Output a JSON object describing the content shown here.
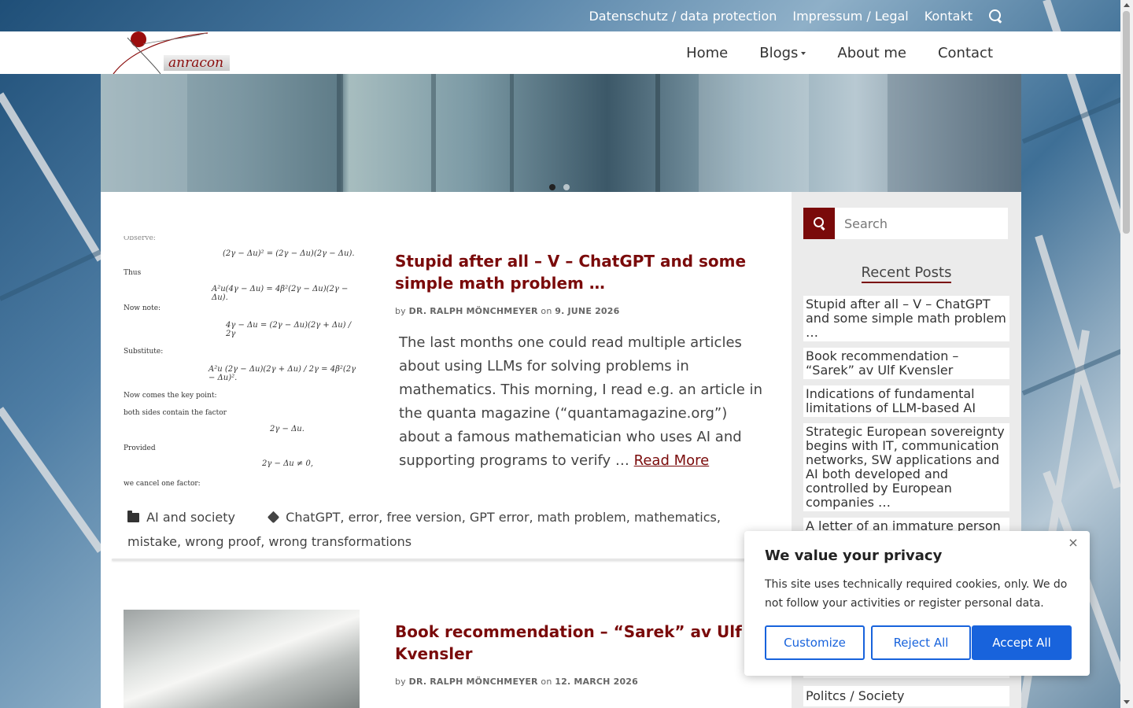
{
  "topbar": {
    "links": [
      "Datenschutz / data protection",
      "Impressum / Legal",
      "Kontakt"
    ],
    "search_icon": "search-icon"
  },
  "header": {
    "logo_text": "anracon",
    "nav": {
      "home": "Home",
      "blogs": "Blogs",
      "about": "About me",
      "contact": "Contact"
    }
  },
  "hero": {
    "slides_total": 2,
    "active_slide": 1
  },
  "posts": [
    {
      "title": "Stupid after all – V – ChatGPT and some simple math problem …",
      "meta_by": "by",
      "author": "DR. RALPH MÖNCHMEYER",
      "meta_on": "on",
      "date": "9. JUNE 2026",
      "excerpt": "The last months one could read multiple articles about using LLMs for solving problems in mathematics. This morning, I read e.g. an article in the quanta magazine (“quantamagazine.org”) about a famous mathematician who uses AI and supporting programs to verify …",
      "read_more": "Read More",
      "category": "AI and society",
      "tags": [
        "ChatGPT",
        "error",
        "free version",
        "GPT error",
        "math problem",
        "mathematics",
        "mistake",
        "wrong proof",
        "wrong transformations"
      ],
      "thumb_math": {
        "top_fragment": "Observe:",
        "eq1": "(2γ − Δu)² = (2γ − Δu)(2γ − Δu).",
        "l1": "Thus",
        "eq2": "A²u(4γ − Δu) = 4β²(2γ − Δu)(2γ − Δu).",
        "l2": "Now note:",
        "eq3": "4γ − Δu = (2γ − Δu)(2γ + Δu) / 2γ",
        "l3": "Substitute:",
        "eq4": "A²u (2γ − Δu)(2γ + Δu) / 2γ = 4β²(2γ − Δu)².",
        "l4": "Now comes the key point:",
        "l5": "both sides contain the factor",
        "eq5": "2γ − Δu.",
        "l6": "Provided",
        "eq6": "2γ − Δu ≠ 0,",
        "l7": "we cancel one factor:"
      }
    },
    {
      "title": "Book recommendation – “Sarek” av Ulf Kvensler",
      "meta_by": "by",
      "author": "DR. RALPH MÖNCHMEYER",
      "meta_on": "on",
      "date": "12. MARCH 2026"
    }
  ],
  "sidebar": {
    "search_placeholder": "Search",
    "recent_title": "Recent Posts",
    "recent_posts": [
      "Stupid after all – V – ChatGPT and some simple math problem …",
      "Book recommendation – “Sarek” av Ulf Kvensler",
      "Indications of fundamental limitations of LLM-based AI",
      "Strategic European sovereignty begins with IT, communication networks, SW applications and AI both developed and controlled by European companies …",
      "A letter of an immature person …"
    ],
    "category_visible": "Politcs / Society"
  },
  "cookie": {
    "title": "We value your privacy",
    "text": "This site uses technically required cookies, only. We do not follow your activities or register personal data.",
    "customize": "Customize",
    "reject": "Reject All",
    "accept": "Accept All",
    "accent_color": "#1863dc"
  },
  "colors": {
    "brand": "#7a0a0a",
    "link": "#7a0a0a"
  }
}
